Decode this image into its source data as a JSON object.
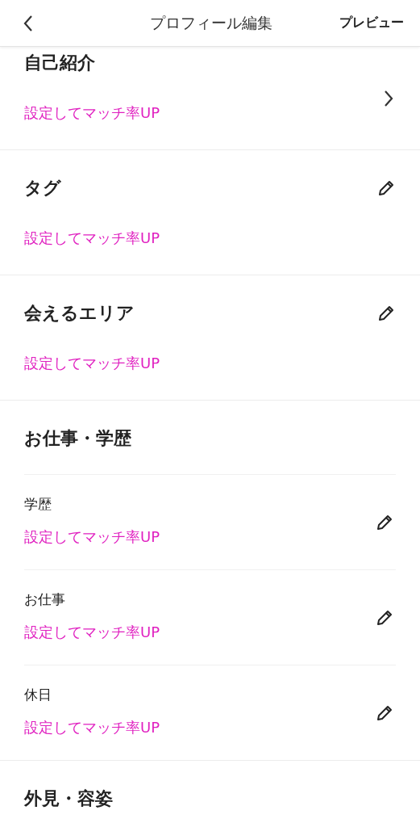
{
  "header": {
    "title": "プロフィール編集",
    "action": "プレビュー"
  },
  "sections": [
    {
      "title": "自己紹介",
      "hint": "設定してマッチ率UP",
      "kind": "chevron"
    },
    {
      "title": "タグ",
      "hint": "設定してマッチ率UP",
      "kind": "edit"
    },
    {
      "title": "会えるエリア",
      "hint": "設定してマッチ率UP",
      "kind": "edit"
    },
    {
      "title": "お仕事・学歴",
      "items": [
        {
          "label": "学歴",
          "hint": "設定してマッチ率UP",
          "kind": "edit"
        },
        {
          "label": "お仕事",
          "hint": "設定してマッチ率UP",
          "kind": "edit"
        },
        {
          "label": "休日",
          "hint": "設定してマッチ率UP",
          "kind": "edit"
        }
      ]
    },
    {
      "title": "外見・容姿"
    }
  ]
}
